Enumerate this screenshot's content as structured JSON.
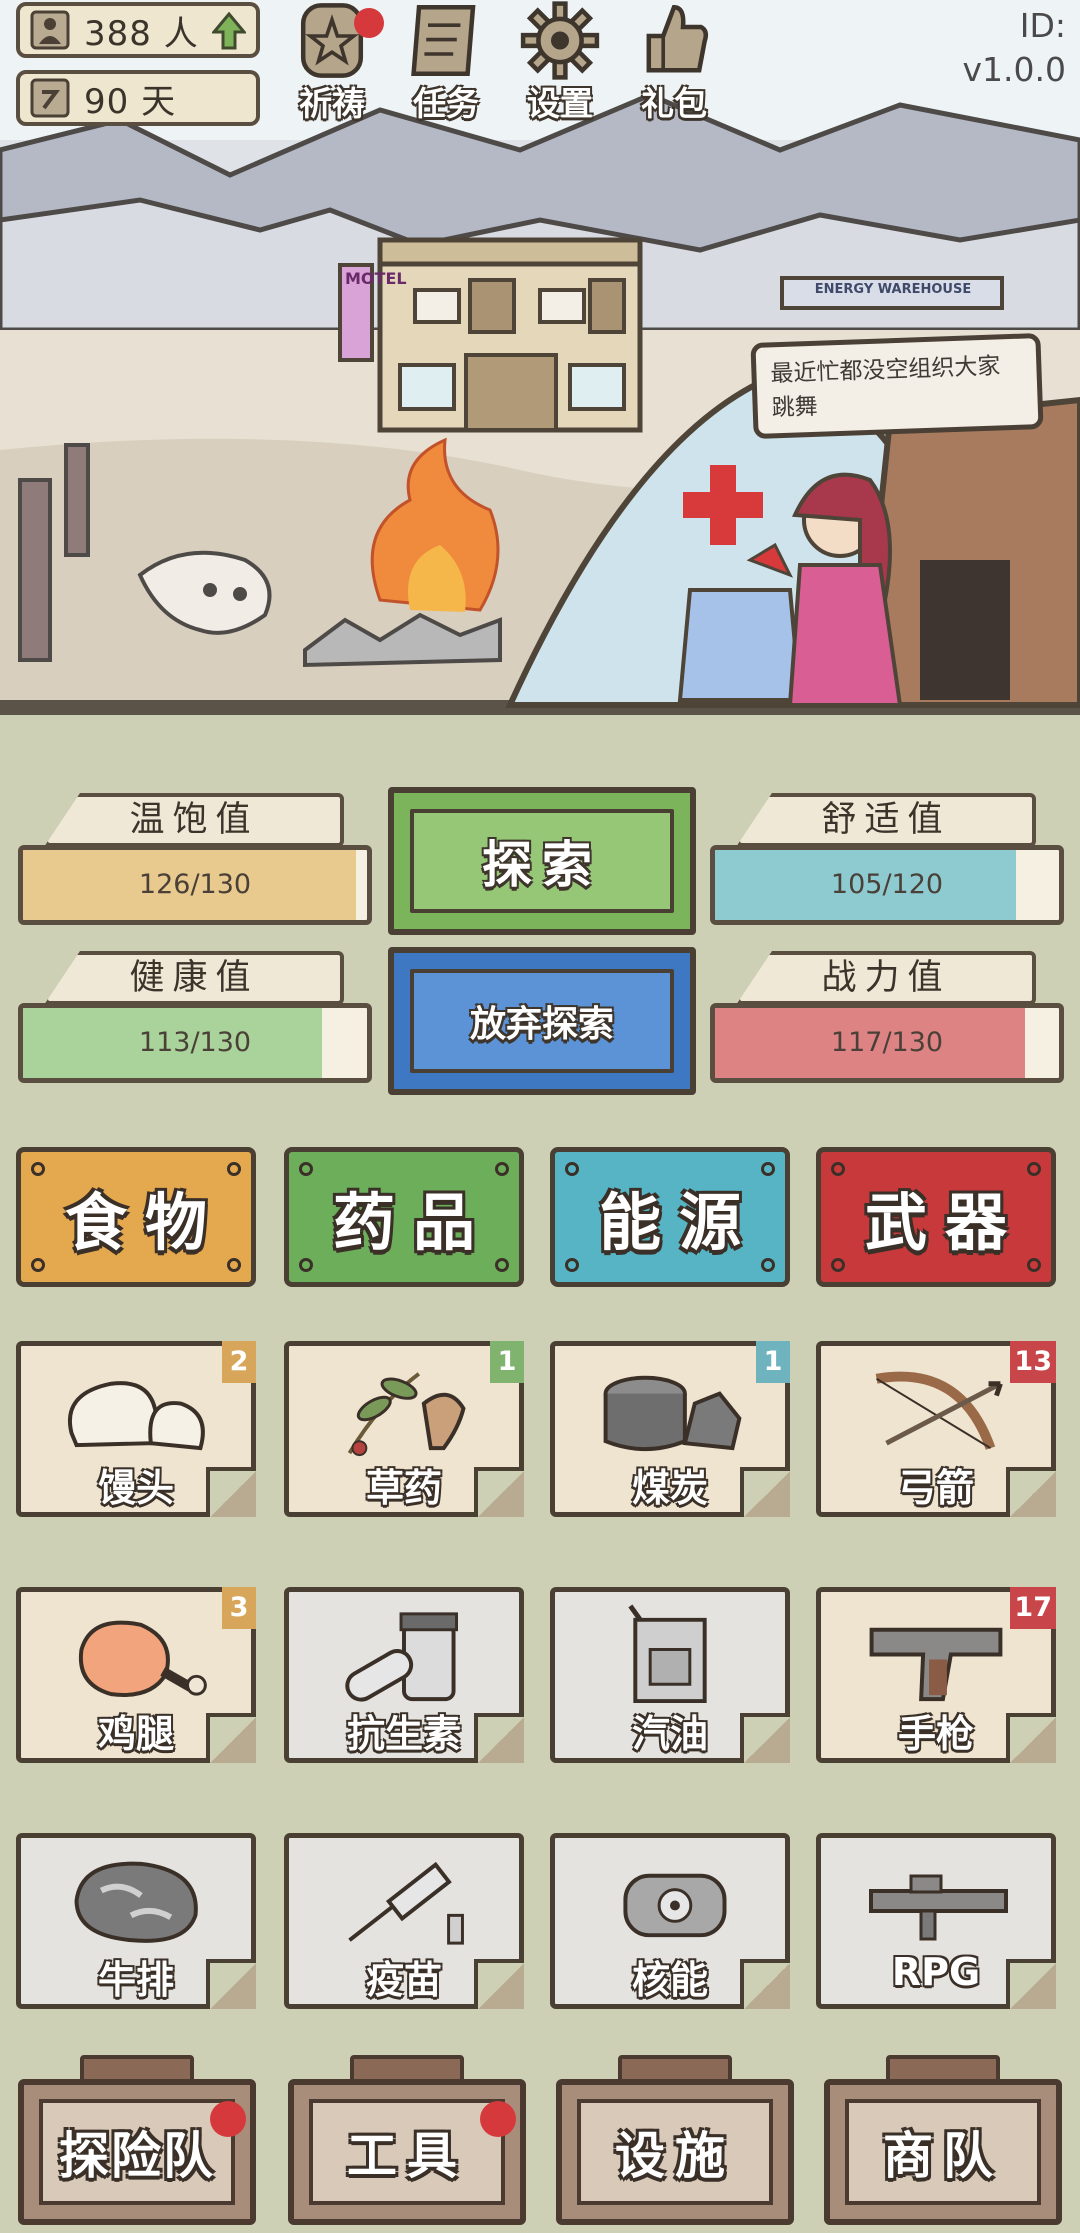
{
  "header": {
    "population": "388 人",
    "days": "90 天",
    "buttons": [
      {
        "label": "祈祷",
        "icon": "star-charm-icon"
      },
      {
        "label": "任务",
        "icon": "scroll-icon"
      },
      {
        "label": "设置",
        "icon": "gear-icon"
      },
      {
        "label": "礼包",
        "icon": "thumbs-up-icon"
      }
    ],
    "id_label": "ID:",
    "version": "v1.0.0"
  },
  "scene": {
    "motel_sign": "MOTEL",
    "warehouse_sign": "ENERGY WAREHOUSE",
    "speech": "最近忙都没空组织大家跳舞"
  },
  "stats": {
    "satiety": {
      "title": "温饱值",
      "value": "126/130",
      "fraction": 0.969,
      "color": "#e8c98e"
    },
    "comfort": {
      "title": "舒适值",
      "value": "105/120",
      "fraction": 0.875,
      "color": "#8ecbd1"
    },
    "health": {
      "title": "健康值",
      "value": "113/130",
      "fraction": 0.869,
      "color": "#a9d39a"
    },
    "combat": {
      "title": "战力值",
      "value": "117/130",
      "fraction": 0.9,
      "color": "#dd8384"
    }
  },
  "actions": {
    "explore": "探索",
    "abandon": "放弃探索"
  },
  "categories": [
    {
      "label": "食物",
      "color": "#e4a84e"
    },
    {
      "label": "药品",
      "color": "#6dae5b"
    },
    {
      "label": "能源",
      "color": "#56b4c4"
    },
    {
      "label": "武器",
      "color": "#c8393b"
    }
  ],
  "items": [
    {
      "name": "馒头",
      "badge": "2",
      "badge_color": "#d8a65a"
    },
    {
      "name": "草药",
      "badge": "1",
      "badge_color": "#7fb36e"
    },
    {
      "name": "煤炭",
      "badge": "1",
      "badge_color": "#6fb3bf"
    },
    {
      "name": "弓箭",
      "badge": "13",
      "badge_color": "#c8454a"
    },
    {
      "name": "鸡腿",
      "badge": "3",
      "badge_color": "#d8a65a"
    },
    {
      "name": "抗生素",
      "badge": "",
      "badge_color": ""
    },
    {
      "name": "汽油",
      "badge": "",
      "badge_color": ""
    },
    {
      "name": "手枪",
      "badge": "17",
      "badge_color": "#c8454a"
    },
    {
      "name": "牛排",
      "badge": "",
      "badge_color": ""
    },
    {
      "name": "疫苗",
      "badge": "",
      "badge_color": ""
    },
    {
      "name": "核能",
      "badge": "",
      "badge_color": ""
    },
    {
      "name": "RPG",
      "badge": "",
      "badge_color": ""
    }
  ],
  "bottom_nav": [
    {
      "label": "探险队",
      "dot": true
    },
    {
      "label": "工具",
      "dot": true
    },
    {
      "label": "设施",
      "dot": false
    },
    {
      "label": "商队",
      "dot": false
    }
  ]
}
